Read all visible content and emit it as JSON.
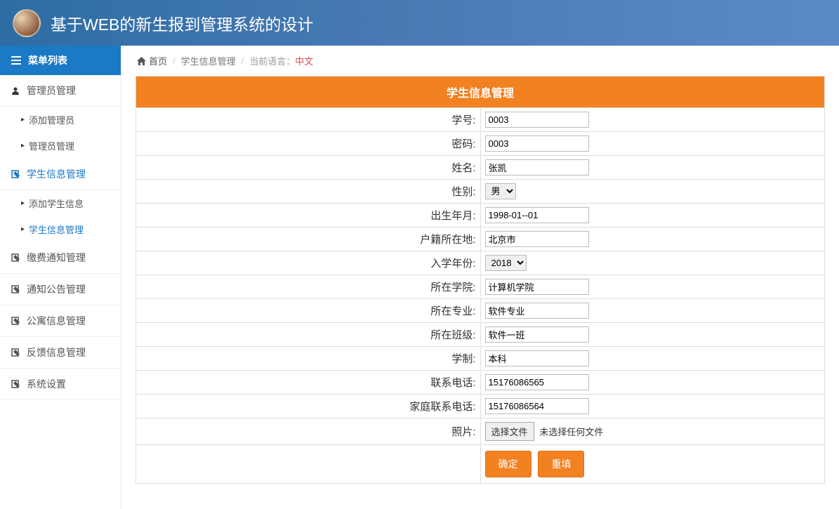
{
  "header": {
    "title": "基于WEB的新生报到管理系统的设计"
  },
  "sidebar": {
    "menu_header": "菜单列表",
    "groups": [
      {
        "label": "管理员管理",
        "items": [
          {
            "label": "添加管理员"
          },
          {
            "label": "管理员管理"
          }
        ]
      },
      {
        "label": "学生信息管理",
        "active": true,
        "items": [
          {
            "label": "添加学生信息"
          },
          {
            "label": "学生信息管理",
            "active": true
          }
        ]
      },
      {
        "label": "缴费通知管理",
        "items": []
      },
      {
        "label": "通知公告管理",
        "items": []
      },
      {
        "label": "公寓信息管理",
        "items": []
      },
      {
        "label": "反馈信息管理",
        "items": []
      },
      {
        "label": "系统设置",
        "items": []
      }
    ]
  },
  "breadcrumb": {
    "home": "首页",
    "section": "学生信息管理",
    "lang_label": "当前语言：",
    "lang_value": "中文"
  },
  "form": {
    "title": "学生信息管理",
    "student_id_label": "学号:",
    "student_id": "0003",
    "password_label": "密码:",
    "password": "0003",
    "name_label": "姓名:",
    "name": "张凯",
    "gender_label": "性别:",
    "gender": "男",
    "birth_label": "出生年月:",
    "birth": "1998-01--01",
    "residence_label": "户籍所在地:",
    "residence": "北京市",
    "enroll_year_label": "入学年份:",
    "enroll_year": "2018",
    "college_label": "所在学院:",
    "college": "计算机学院",
    "major_label": "所在专业:",
    "major": "软件专业",
    "class_label": "所在班级:",
    "class": "软件一班",
    "education_label": "学制:",
    "education": "本科",
    "phone_label": "联系电话:",
    "phone": "15176086565",
    "family_phone_label": "家庭联系电话:",
    "family_phone": "15176086564",
    "photo_label": "照片:",
    "file_button": "选择文件",
    "file_status": "未选择任何文件",
    "submit": "确定",
    "reset": "重填"
  }
}
